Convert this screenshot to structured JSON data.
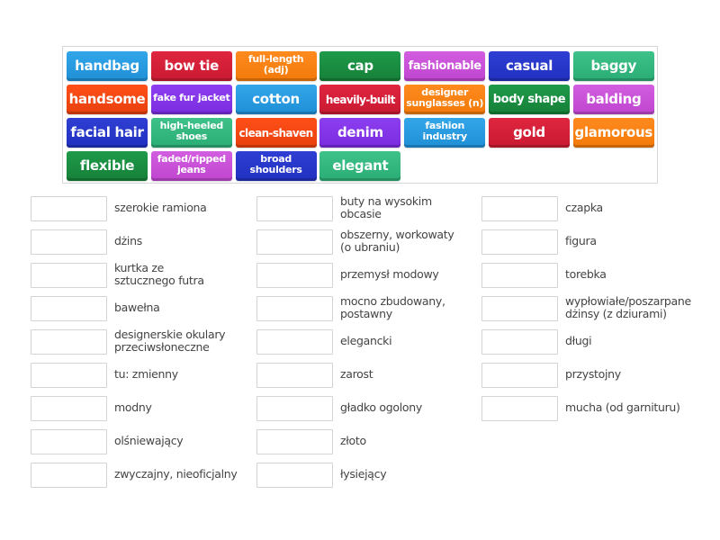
{
  "activity": {
    "type": "match-up",
    "bank_tiles": [
      {
        "text": "handbag",
        "color": "#2196e0"
      },
      {
        "text": "bow tie",
        "color": "#d4203a"
      },
      {
        "text": "full-length (adj)",
        "color": "#f7810f"
      },
      {
        "text": "cap",
        "color": "#1a8c42"
      },
      {
        "text": "fashionable",
        "color": "#c94fd8"
      },
      {
        "text": "casual",
        "color": "#2736ca"
      },
      {
        "text": "baggy",
        "color": "#35b87f"
      },
      {
        "text": "handsome",
        "color": "#f24712"
      },
      {
        "text": "fake fur jacket",
        "color": "#8335e8"
      },
      {
        "text": "cotton",
        "color": "#2a9de5"
      },
      {
        "text": "heavily-built",
        "color": "#d4203a"
      },
      {
        "text": "designer sunglasses (n)",
        "color": "#f7810f"
      },
      {
        "text": "body shape",
        "color": "#1a8c42"
      },
      {
        "text": "balding",
        "color": "#c94fd8"
      },
      {
        "text": "facial hair",
        "color": "#2736ca"
      },
      {
        "text": "high-heeled shoes",
        "color": "#35b87f"
      },
      {
        "text": "clean-shaven",
        "color": "#f24712"
      },
      {
        "text": "denim",
        "color": "#8335e8"
      },
      {
        "text": "fashion industry",
        "color": "#2a9de5"
      },
      {
        "text": "gold",
        "color": "#d4203a"
      },
      {
        "text": "glamorous",
        "color": "#f7810f"
      },
      {
        "text": "flexible",
        "color": "#1a8c42"
      },
      {
        "text": "faded/ripped jeans",
        "color": "#c94fd8"
      },
      {
        "text": "broad shoulders",
        "color": "#2736ca"
      },
      {
        "text": "elegant",
        "color": "#35b87f"
      }
    ],
    "targets": {
      "col1": [
        {
          "line1": "szerokie ramiona",
          "line2": "",
          "value": ""
        },
        {
          "line1": "dżins",
          "line2": "",
          "value": ""
        },
        {
          "line1": "kurtka ze",
          "line2": "sztucznego futra",
          "value": ""
        },
        {
          "line1": "bawełna",
          "line2": "",
          "value": ""
        },
        {
          "line1": "designerskie okulary",
          "line2": "przeciwsłoneczne",
          "value": ""
        },
        {
          "line1": "tu: zmienny",
          "line2": "",
          "value": ""
        },
        {
          "line1": "modny",
          "line2": "",
          "value": ""
        },
        {
          "line1": "olśniewający",
          "line2": "",
          "value": ""
        },
        {
          "line1": "zwyczajny, nieoficjalny",
          "line2": "",
          "value": ""
        }
      ],
      "col2": [
        {
          "line1": "buty na wysokim",
          "line2": "obcasie",
          "value": ""
        },
        {
          "line1": "obszerny, workowaty",
          "line2": "(o ubraniu)",
          "value": ""
        },
        {
          "line1": "przemysł modowy",
          "line2": "",
          "value": ""
        },
        {
          "line1": "mocno zbudowany,",
          "line2": "postawny",
          "value": ""
        },
        {
          "line1": "elegancki",
          "line2": "",
          "value": ""
        },
        {
          "line1": "zarost",
          "line2": "",
          "value": ""
        },
        {
          "line1": "gładko ogolony",
          "line2": "",
          "value": ""
        },
        {
          "line1": "złoto",
          "line2": "",
          "value": ""
        },
        {
          "line1": "łysiejący",
          "line2": "",
          "value": ""
        }
      ],
      "col3": [
        {
          "line1": "czapka",
          "line2": "",
          "value": ""
        },
        {
          "line1": "figura",
          "line2": "",
          "value": ""
        },
        {
          "line1": "torebka",
          "line2": "",
          "value": ""
        },
        {
          "line1": "wypłowiałe/poszarpane",
          "line2": "dżinsy (z dziurami)",
          "value": ""
        },
        {
          "line1": "długi",
          "line2": "",
          "value": ""
        },
        {
          "line1": "przystojny",
          "line2": "",
          "value": ""
        },
        {
          "line1": "mucha (od garnituru)",
          "line2": "",
          "value": ""
        }
      ]
    }
  }
}
